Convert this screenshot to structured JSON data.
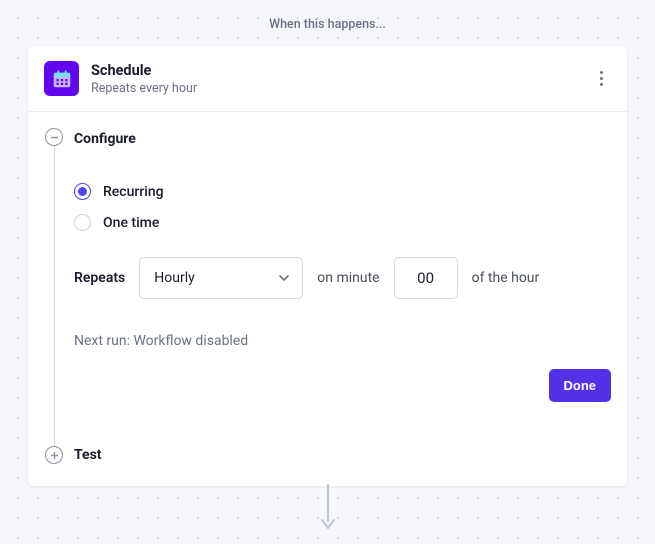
{
  "header": {
    "text": "When this happens..."
  },
  "card": {
    "title": "Schedule",
    "subtitle": "Repeats every hour",
    "configure": {
      "label": "Configure"
    },
    "scheduleType": {
      "options": [
        {
          "label": "Recurring",
          "selected": true
        },
        {
          "label": "One time",
          "selected": false
        }
      ]
    },
    "repeats": {
      "label": "Repeats",
      "selected": "Hourly",
      "onMinuteLabel": "on minute",
      "minuteValue": "00",
      "ofHourLabel": "of the hour"
    },
    "nextRun": "Next run: Workflow disabled",
    "doneLabel": "Done",
    "test": {
      "label": "Test"
    }
  }
}
